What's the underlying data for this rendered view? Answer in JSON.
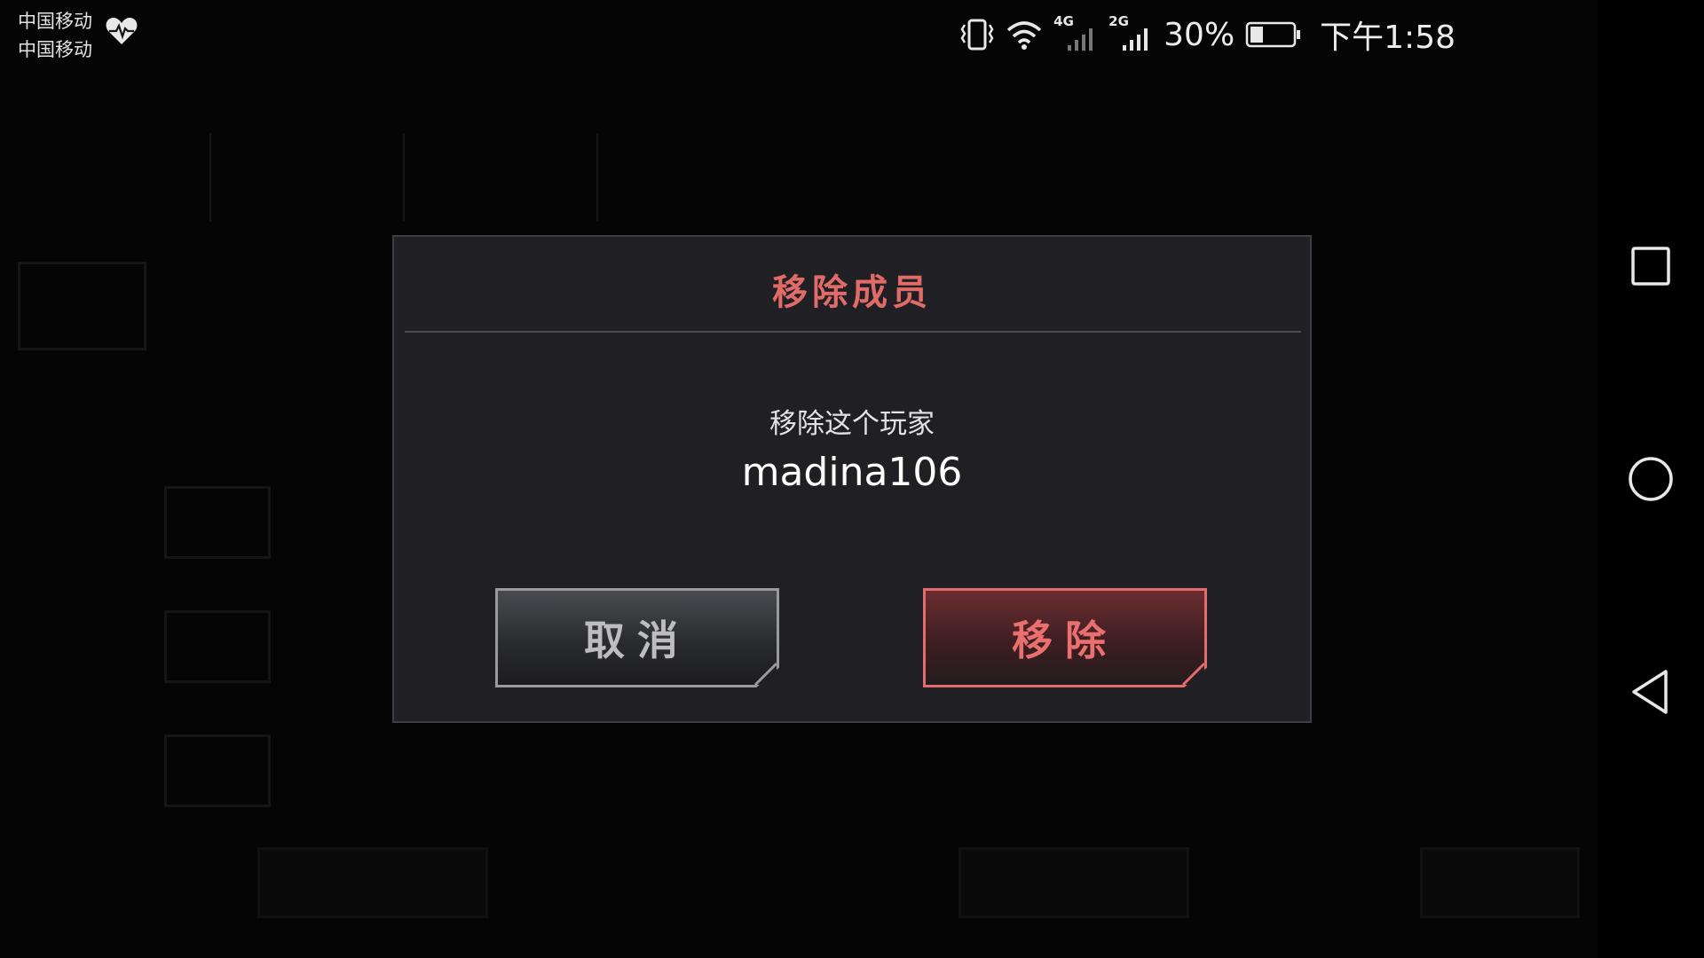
{
  "status_bar": {
    "carrier_1": "中国移动",
    "carrier_2": "中国移动",
    "network_4g": "4G",
    "network_2g": "2G",
    "battery_percent": "30%",
    "battery_level": 0.3,
    "time": "下午1:58",
    "icons": [
      "health-icon",
      "vibrate-icon",
      "wifi-icon",
      "signal-4g-icon",
      "signal-2g-icon",
      "battery-icon"
    ]
  },
  "dialog": {
    "title": "移除成员",
    "message": "移除这个玩家",
    "player_name": "madina106",
    "cancel_label": "取消",
    "remove_label": "移除"
  },
  "nav_bar": {
    "icons": [
      "recents-icon",
      "home-icon",
      "back-icon"
    ]
  },
  "colors": {
    "accent_red": "#e06b68",
    "dialog_bg": "#202024",
    "overlay": "#050505"
  }
}
